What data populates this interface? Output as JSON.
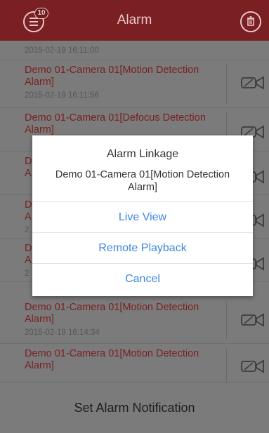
{
  "header": {
    "title": "Alarm",
    "badge_count": "10",
    "menu_icon": "menu-icon",
    "trash_icon": "trash-icon",
    "accent_color": "#7a1f22"
  },
  "alarms": [
    {
      "title": "",
      "time": "2015-02-19 16:11:00"
    },
    {
      "title": "Demo 01-Camera 01[Motion Detection Alarm]",
      "time": "2015-02-19 16:11:56"
    },
    {
      "title": "Demo 01-Camera 01[Defocus Detection Alarm]",
      "time": ""
    },
    {
      "title": "D A",
      "time": ""
    },
    {
      "title": "D A",
      "time": "2"
    },
    {
      "title": "D A",
      "time": "2"
    },
    {
      "title": "Demo 01-Camera 01[Motion Detection Alarm]",
      "time": "2015-02-19 16:14:34"
    },
    {
      "title": "Demo 01-Camera 01[Motion Detection Alarm]",
      "time": ""
    }
  ],
  "dialog": {
    "title": "Alarm Linkage",
    "message": "Demo 01-Camera 01[Motion Detection Alarm]",
    "buttons": [
      "Live View",
      "Remote Playback",
      "Cancel"
    ],
    "button_color": "#3f86e2"
  },
  "bottom": {
    "label": "Set Alarm Notification"
  }
}
